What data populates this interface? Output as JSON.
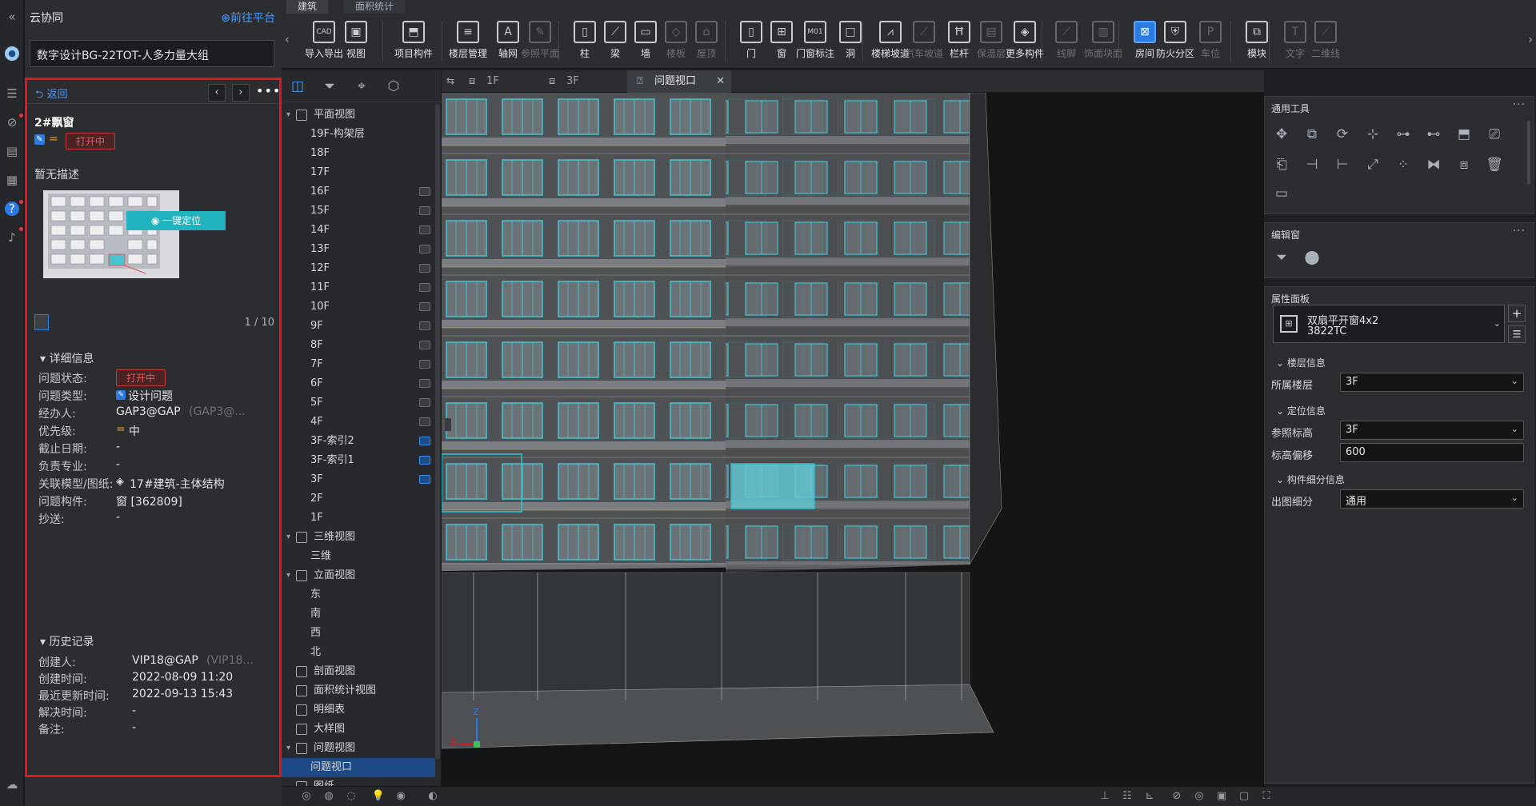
{
  "app": {
    "title": "云协同",
    "goto_platform": "前往平台",
    "project": "数字设计BG-22TOT-人多力量大组"
  },
  "issue": {
    "back": "返回",
    "title": "2#飘窗",
    "status_badge": "打开中",
    "desc": "暂无描述",
    "locate_btn": "一键定位",
    "pager": "1 / 10",
    "detail_section": "详细信息",
    "details": [
      {
        "label": "问题状态:",
        "value": "打开中"
      },
      {
        "label": "问题类型:",
        "value": "设计问题"
      },
      {
        "label": "经办人:",
        "value": "GAP3@GAP",
        "value_dim": "(GAP3@..."
      },
      {
        "label": "优先级:",
        "value": "中"
      },
      {
        "label": "截止日期:",
        "value": "-"
      },
      {
        "label": "负责专业:",
        "value": "-"
      },
      {
        "label": "关联模型/图纸:",
        "value": "17#建筑-主体结构"
      },
      {
        "label": "问题构件:",
        "value": "窗 [362809]"
      },
      {
        "label": "抄送:",
        "value": "-"
      }
    ],
    "history_section": "历史记录",
    "history": [
      {
        "label": "创建人:",
        "value": "VIP18@GAP",
        "value_dim": "(VIP18..."
      },
      {
        "label": "创建时间:",
        "value": "2022-08-09 11:20"
      },
      {
        "label": "最近更新时间:",
        "value": "2022-09-13 15:43"
      },
      {
        "label": "解决时间:",
        "value": "-"
      },
      {
        "label": "备注:",
        "value": "-"
      }
    ]
  },
  "ribbon": {
    "tabs": [
      "建筑",
      "面积统计"
    ],
    "tools": [
      {
        "label": "导入导出",
        "icon": "CAD"
      },
      {
        "label": "视图",
        "icon": "▣"
      },
      {
        "label": "项目构件",
        "icon": "⬒"
      },
      {
        "label": "楼层管理",
        "icon": "≡"
      },
      {
        "label": "轴网",
        "icon": "A"
      },
      {
        "label": "参照平面",
        "icon": "✎"
      },
      {
        "label": "柱",
        "icon": "▯"
      },
      {
        "label": "梁",
        "icon": "⟋"
      },
      {
        "label": "墙",
        "icon": "▭"
      },
      {
        "label": "楼板",
        "icon": "◇"
      },
      {
        "label": "屋顶",
        "icon": "⌂"
      },
      {
        "label": "门",
        "icon": "▯"
      },
      {
        "label": "窗",
        "icon": "⊞"
      },
      {
        "label": "门窗标注",
        "icon": "M01"
      },
      {
        "label": "洞",
        "icon": "□"
      },
      {
        "label": "楼梯坡道",
        "icon": "⩘"
      },
      {
        "label": "汽车坡道",
        "icon": "⟋"
      },
      {
        "label": "栏杆",
        "icon": "Ħ"
      },
      {
        "label": "保温层",
        "icon": "▤"
      },
      {
        "label": "更多构件",
        "icon": "◈"
      },
      {
        "label": "线脚",
        "icon": "⟋"
      },
      {
        "label": "饰面块面",
        "icon": "▥"
      },
      {
        "label": "房间",
        "icon": "⊠"
      },
      {
        "label": "防火分区",
        "icon": "⛨"
      },
      {
        "label": "车位",
        "icon": "P"
      },
      {
        "label": "模块",
        "icon": "⧉"
      },
      {
        "label": "文字",
        "icon": "T"
      },
      {
        "label": "二维线",
        "icon": "⟋"
      }
    ]
  },
  "tree": {
    "items": [
      {
        "label": "平面视图"
      },
      {
        "label": "19F-构架层"
      },
      {
        "label": "18F"
      },
      {
        "label": "17F"
      },
      {
        "label": "16F"
      },
      {
        "label": "15F"
      },
      {
        "label": "14F"
      },
      {
        "label": "13F"
      },
      {
        "label": "12F"
      },
      {
        "label": "11F"
      },
      {
        "label": "10F"
      },
      {
        "label": "9F"
      },
      {
        "label": "8F"
      },
      {
        "label": "7F"
      },
      {
        "label": "6F"
      },
      {
        "label": "5F"
      },
      {
        "label": "4F"
      },
      {
        "label": "3F-索引2"
      },
      {
        "label": "3F-索引1"
      },
      {
        "label": "3F"
      },
      {
        "label": "2F"
      },
      {
        "label": "1F"
      },
      {
        "label": "三维视图"
      },
      {
        "label": "三维"
      },
      {
        "label": "立面视图"
      },
      {
        "label": "东"
      },
      {
        "label": "南"
      },
      {
        "label": "西"
      },
      {
        "label": "北"
      },
      {
        "label": "剖面视图"
      },
      {
        "label": "面积统计视图"
      },
      {
        "label": "明细表"
      },
      {
        "label": "大样图"
      },
      {
        "label": "问题视图"
      },
      {
        "label": "问题视口"
      },
      {
        "label": "图纸"
      }
    ]
  },
  "viewport": {
    "tabs": [
      "1F",
      "3F",
      "问题视口"
    ],
    "axis_x": "X",
    "axis_z": "Z"
  },
  "right": {
    "tools_title": "通用工具",
    "edit_title": "编辑窗",
    "prop_title": "属性面板",
    "component_name": "双扇平开窗4x2",
    "component_code": "3822TC",
    "sec_floor": "楼层信息",
    "floor_label": "所属楼层",
    "floor_value": "3F",
    "sec_pos": "定位信息",
    "ref_label": "参照标高",
    "ref_value": "3F",
    "offset_label": "标高偏移",
    "offset_value": "600",
    "sec_detail": "构件细分信息",
    "detail_label": "出图细分",
    "detail_value": "通用"
  },
  "colors": {
    "accent": "#2c7be5",
    "danger": "#e3161b",
    "window_cyan": "#35c8d8"
  }
}
